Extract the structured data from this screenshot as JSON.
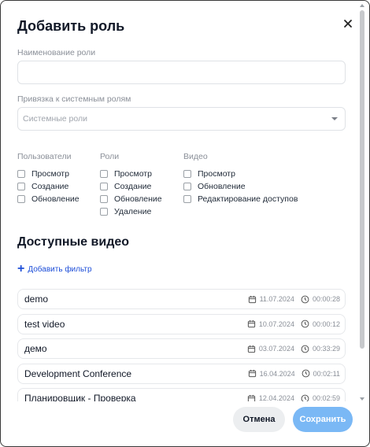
{
  "dialog": {
    "title": "Добавить роль",
    "close_icon": "close-icon"
  },
  "form": {
    "role_name_label": "Наименование роли",
    "role_name_value": "",
    "system_roles_label": "Привязка к системным ролям",
    "system_roles_placeholder": "Системные роли"
  },
  "permissions": [
    {
      "group": "Пользователи",
      "items": [
        "Просмотр",
        "Создание",
        "Обновление"
      ]
    },
    {
      "group": "Роли",
      "items": [
        "Просмотр",
        "Создание",
        "Обновление",
        "Удаление"
      ]
    },
    {
      "group": "Видео",
      "items": [
        "Просмотр",
        "Обновление",
        "Редактирование доступов"
      ]
    }
  ],
  "videos_section": {
    "title": "Доступные видео",
    "add_filter_label": "Добавить фильтр",
    "items": [
      {
        "name": "demo",
        "date": "11.07.2024",
        "duration": "00:00:28"
      },
      {
        "name": "test video",
        "date": "10.07.2024",
        "duration": "00:00:12"
      },
      {
        "name": "демо",
        "date": "03.07.2024",
        "duration": "00:33:29"
      },
      {
        "name": "Development Conference",
        "date": "16.04.2024",
        "duration": "00:02:11"
      },
      {
        "name": "Планировщик - Проверка",
        "date": "12.04.2024",
        "duration": "00:02:59"
      }
    ]
  },
  "footer": {
    "cancel_label": "Отмена",
    "save_label": "Сохранить"
  },
  "colors": {
    "accent_link": "#1d4ed8",
    "save_button": "#7ab8f5",
    "cancel_button": "#eceef0"
  }
}
